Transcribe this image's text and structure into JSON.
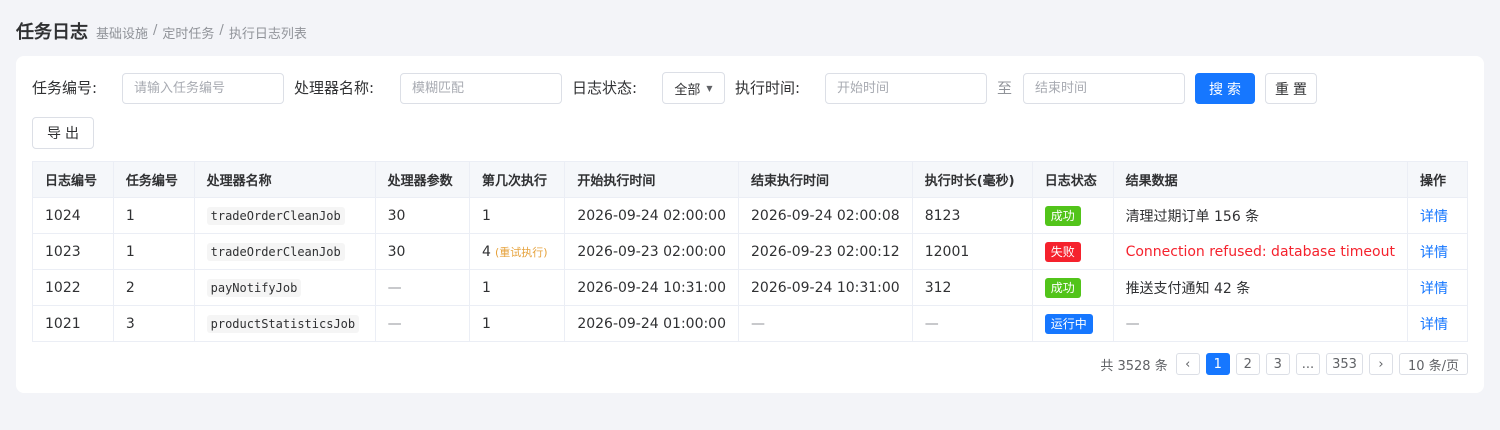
{
  "header": {
    "title": "任务日志",
    "breadcrumb": [
      "基础设施",
      "定时任务",
      "执行日志列表"
    ],
    "separator": "/"
  },
  "filters": {
    "task_id_label": "任务编号:",
    "task_id_placeholder": "请输入任务编号",
    "handler_label": "处理器名称:",
    "handler_placeholder": "模糊匹配",
    "status_label": "日志状态:",
    "status_value": "全部",
    "time_label": "执行时间:",
    "start_placeholder": "开始时间",
    "to": "至",
    "end_placeholder": "结束时间",
    "search": "搜索",
    "reset": "重置",
    "export": "导出"
  },
  "table": {
    "columns": [
      "日志编号",
      "任务编号",
      "处理器名称",
      "处理器参数",
      "第几次执行",
      "开始执行时间",
      "结束执行时间",
      "执行时长(毫秒)",
      "日志状态",
      "结果数据",
      "操作"
    ],
    "rows": [
      {
        "log_id": "1024",
        "task_id": "1",
        "handler": "tradeOrderCleanJob",
        "param": "30",
        "exec_no": "1",
        "retry": "",
        "start": "2026-09-24 02:00:00",
        "end": "2026-09-24 02:00:08",
        "duration": "8123",
        "status": "成功",
        "status_type": "success",
        "result": "清理过期订单 156 条",
        "result_type": "normal",
        "action": "详情"
      },
      {
        "log_id": "1023",
        "task_id": "1",
        "handler": "tradeOrderCleanJob",
        "param": "30",
        "exec_no": "4",
        "retry": "(重试执行)",
        "start": "2026-09-23 02:00:00",
        "end": "2026-09-23 02:00:12",
        "duration": "12001",
        "status": "失败",
        "status_type": "fail",
        "result": "Connection refused: database timeout",
        "result_type": "error",
        "action": "详情"
      },
      {
        "log_id": "1022",
        "task_id": "2",
        "handler": "payNotifyJob",
        "param": "—",
        "exec_no": "1",
        "retry": "",
        "start": "2026-09-24 10:31:00",
        "end": "2026-09-24 10:31:00",
        "duration": "312",
        "status": "成功",
        "status_type": "success",
        "result": "推送支付通知 42 条",
        "result_type": "normal",
        "action": "详情"
      },
      {
        "log_id": "1021",
        "task_id": "3",
        "handler": "productStatisticsJob",
        "param": "—",
        "exec_no": "1",
        "retry": "",
        "start": "2026-09-24 01:00:00",
        "end": "—",
        "duration": "—",
        "status": "运行中",
        "status_type": "running",
        "result": "—",
        "result_type": "dash",
        "action": "详情"
      }
    ]
  },
  "pagination": {
    "total": "共 3528 条",
    "prev": "‹",
    "next": "›",
    "pages": [
      "1",
      "2",
      "3",
      "...",
      "353"
    ],
    "current": "1",
    "page_size": "10 条/页"
  },
  "colors": {
    "primary": "#1677ff",
    "success": "#52c41a",
    "fail": "#f5222d",
    "warning": "#e6a23c"
  }
}
